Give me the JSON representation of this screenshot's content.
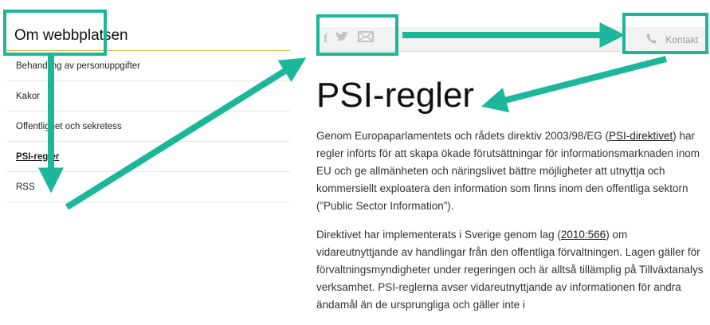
{
  "sidebar": {
    "title": "Om webbplatsen",
    "items": [
      {
        "label": "Behandling av personuppgifter",
        "active": false
      },
      {
        "label": "Kakor",
        "active": false
      },
      {
        "label": "Offentlighet och sekretess",
        "active": false
      },
      {
        "label": "PSI-regler",
        "active": true
      },
      {
        "label": "RSS",
        "active": false
      }
    ]
  },
  "topbar": {
    "icons": [
      "facebook-icon",
      "twitter-icon",
      "mail-icon"
    ],
    "contact_label": "Kontakt"
  },
  "main": {
    "title": "PSI-regler",
    "p1_pre": "Genom Europaparlamentets och rådets direktiv 2003/98/EG (",
    "p1_link": "PSI-direktivet",
    "p1_post": ") har regler införts för att skapa ökade förutsättningar för informationsmarknaden inom EU och ge allmänheten och näringslivet bättre möjligheter att utnyttja och kommersiellt exploatera den information som finns inom den offentliga sektorn (”Public Sector Information”).",
    "p2_pre": "Direktivet har implementerats i Sverige genom lag (",
    "p2_link": "2010:566",
    "p2_post": ") om vidareutnyttjande av handlingar från den offentliga förvaltningen. Lagen gäller för förvaltningsmyndigheter under regeringen och är alltså tillämplig på Tillväxtanalys verksamhet. PSI-reglerna avser vidareutnyttjande av informationen för andra ändamål än de ursprungliga och gäller inte i"
  },
  "colors": {
    "annotation": "#1cb69a",
    "rule": "#d9b54a"
  }
}
